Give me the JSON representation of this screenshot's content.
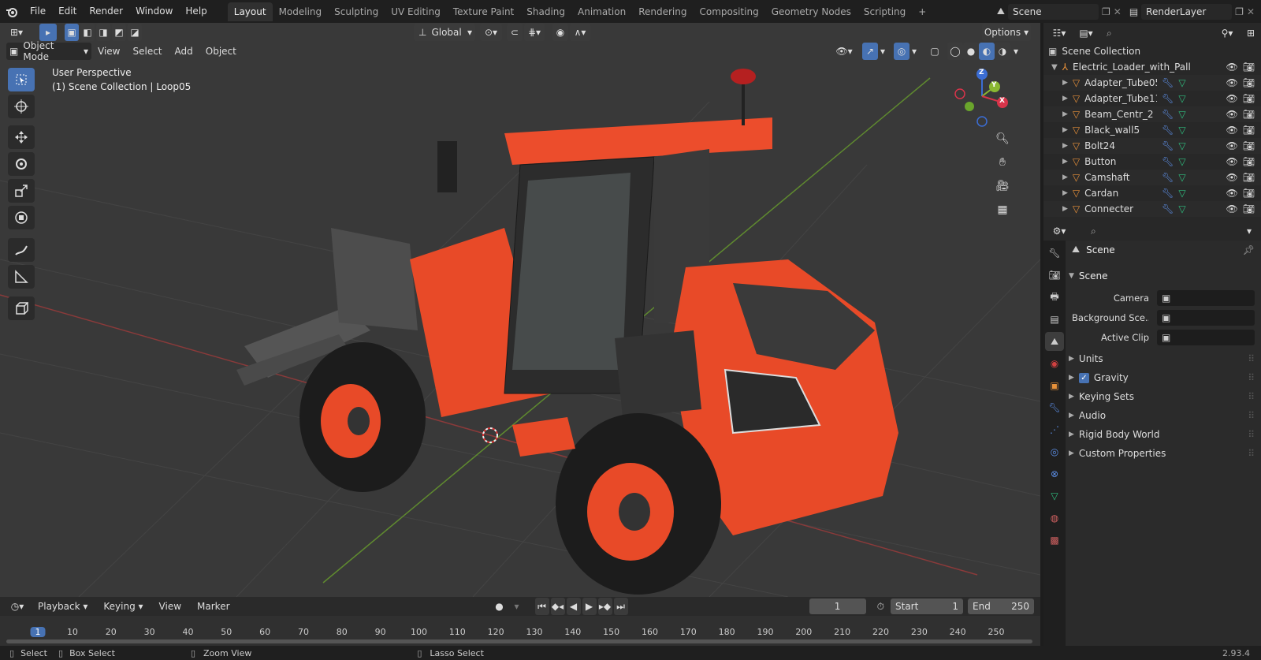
{
  "topbar": {
    "menus": [
      "File",
      "Edit",
      "Render",
      "Window",
      "Help"
    ],
    "workspaces": [
      "Layout",
      "Modeling",
      "Sculpting",
      "UV Editing",
      "Texture Paint",
      "Shading",
      "Animation",
      "Rendering",
      "Compositing",
      "Geometry Nodes",
      "Scripting"
    ],
    "active_workspace": "Layout",
    "scene": "Scene",
    "view_layer": "RenderLayer"
  },
  "viewport": {
    "mode": "Object Mode",
    "menus": [
      "View",
      "Select",
      "Add",
      "Object"
    ],
    "transform_orientation": "Global",
    "options_label": "Options",
    "overlay_title": "User Perspective",
    "overlay_subtitle": "(1) Scene Collection | Loop05",
    "gizmo_axes": [
      "X",
      "Y",
      "Z"
    ]
  },
  "outliner": {
    "root": "Scene Collection",
    "parent": "Electric_Loader_with_Pallet_l",
    "items": [
      "Adapter_Tube05",
      "Adapter_Tube11",
      "Beam_Centr_2",
      "Black_wall5",
      "Bolt24",
      "Button",
      "Camshaft",
      "Cardan",
      "Connecter"
    ]
  },
  "properties": {
    "context": "Scene",
    "section": "Scene",
    "fields": [
      {
        "label": "Camera",
        "value": ""
      },
      {
        "label": "Background Sce...",
        "value": ""
      },
      {
        "label": "Active Clip",
        "value": ""
      }
    ],
    "panels": [
      "Units",
      "Gravity",
      "Keying Sets",
      "Audio",
      "Rigid Body World",
      "Custom Properties"
    ],
    "gravity_checked": true
  },
  "timeline": {
    "menus": [
      "Playback",
      "Keying",
      "View",
      "Marker"
    ],
    "current_frame": "1",
    "start_label": "Start",
    "start": "1",
    "end_label": "End",
    "end": "250",
    "ticks": [
      "1",
      "10",
      "20",
      "30",
      "40",
      "50",
      "60",
      "70",
      "80",
      "90",
      "100",
      "110",
      "120",
      "130",
      "140",
      "150",
      "160",
      "170",
      "180",
      "190",
      "200",
      "210",
      "220",
      "230",
      "240",
      "250"
    ]
  },
  "statusbar": {
    "select": "Select",
    "box_select": "Box Select",
    "zoom_view": "Zoom View",
    "lasso_select": "Lasso Select",
    "version": "2.93.4"
  },
  "colors": {
    "accent": "#4772b3",
    "loader_orange": "#e84a28",
    "bg": "#393939"
  }
}
